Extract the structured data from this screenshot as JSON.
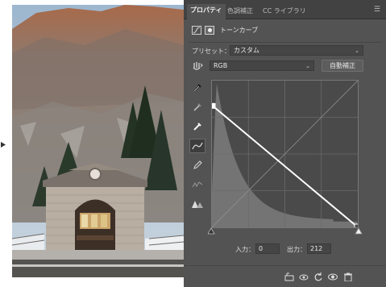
{
  "tabs": [
    {
      "label": "プロパティ",
      "active": true
    },
    {
      "label": "色調補正",
      "active": false
    },
    {
      "label": "CC ライブラリ",
      "active": false
    }
  ],
  "panel": {
    "title": "トーンカーブ",
    "preset_label": "プリセット：",
    "preset_value": "カスタム",
    "channel_value": "RGB",
    "auto_button": "自動補正"
  },
  "io": {
    "input_label": "入力：",
    "input_value": "0",
    "output_label": "出力：",
    "output_value": "212"
  },
  "curve": {
    "points": [
      [
        0,
        212
      ],
      [
        255,
        0
      ]
    ]
  },
  "colors": {
    "panel_bg": "#535353",
    "tab_bar": "#424242",
    "graph_bg": "#4a4a4a",
    "curve": "#ffffff"
  },
  "icons": [
    "finger-adjust-icon",
    "eyedropper-black-icon",
    "eyedropper-gray-icon",
    "eyedropper-white-icon",
    "curve-edit-icon",
    "pencil-icon",
    "smooth-icon",
    "clipping-warning-icon",
    "clip-to-layer-icon",
    "view-previous-icon",
    "reset-icon",
    "visibility-icon",
    "trash-icon"
  ]
}
